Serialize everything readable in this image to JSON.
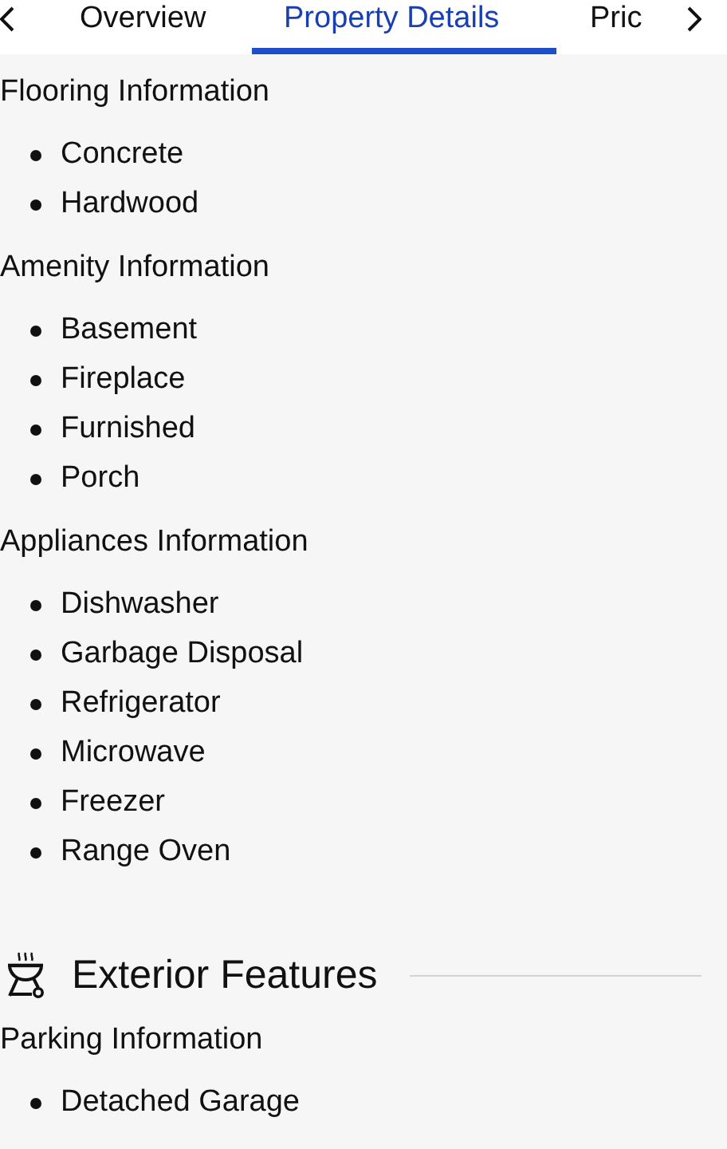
{
  "tabs": [
    {
      "label": "Overview",
      "selected": false
    },
    {
      "label": "Property Details",
      "selected": true
    },
    {
      "label": "Pric",
      "selected": false
    }
  ],
  "sections": [
    {
      "groups": [
        {
          "title": "Flooring Information",
          "items": [
            "Concrete",
            "Hardwood"
          ]
        },
        {
          "title": "Amenity Information",
          "items": [
            "Basement",
            "Fireplace",
            "Furnished",
            "Porch"
          ]
        },
        {
          "title": "Appliances Information",
          "items": [
            "Dishwasher",
            "Garbage Disposal",
            "Refrigerator",
            "Microwave",
            "Freezer",
            "Range Oven"
          ]
        }
      ]
    },
    {
      "title": "Exterior Features",
      "groups": [
        {
          "title": "Parking Information",
          "items": [
            "Detached Garage"
          ]
        }
      ]
    }
  ]
}
